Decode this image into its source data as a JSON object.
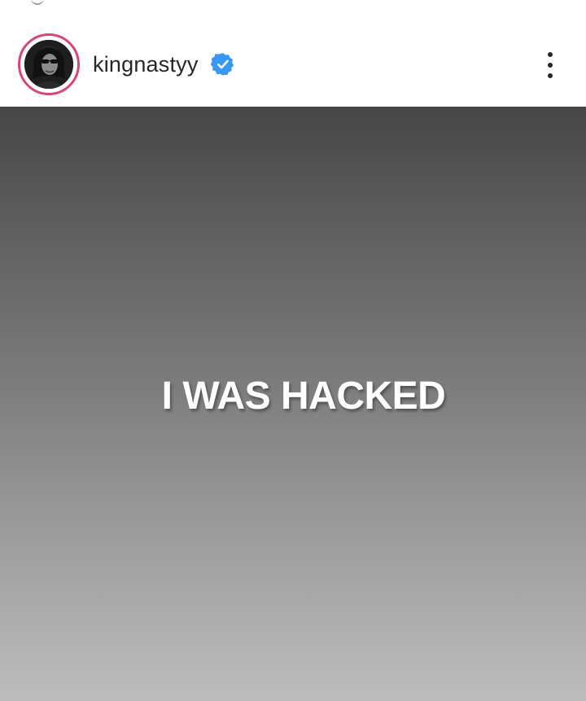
{
  "post": {
    "username": "kingnastyy",
    "verified": true,
    "media_text": "I WAS HACKED"
  },
  "colors": {
    "story_ring": "#d9466f",
    "verified_badge": "#3897f0",
    "username_text": "#262626",
    "media_gradient_top": "#464646",
    "media_gradient_bottom": "#bdbdbd"
  },
  "icons": {
    "verified": "verified-badge-icon",
    "more": "more-options-icon",
    "avatar": "profile-avatar"
  }
}
